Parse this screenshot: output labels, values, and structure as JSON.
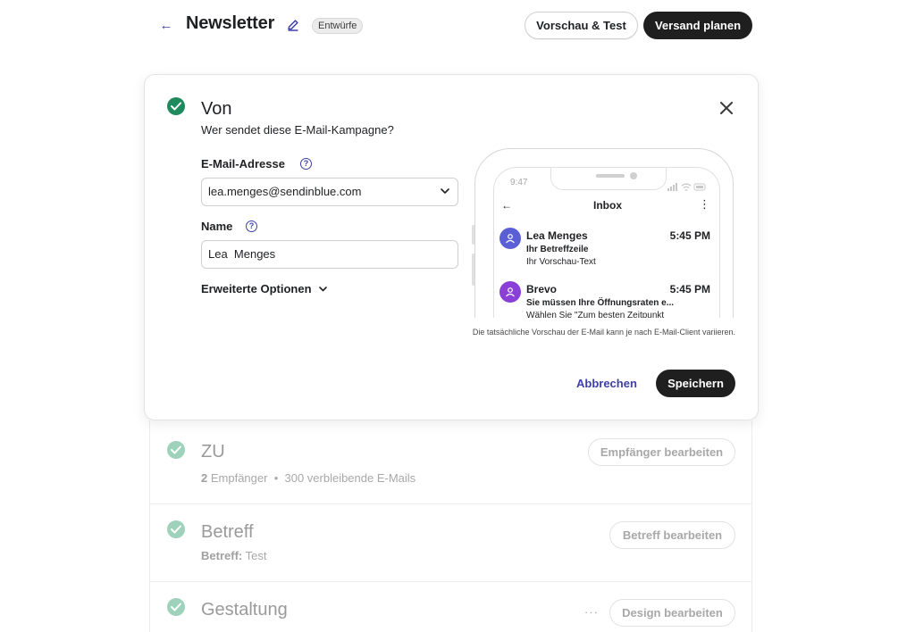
{
  "header": {
    "title": "Newsletter",
    "badge": "Entwürfe",
    "preview_test_label": "Vorschau & Test",
    "schedule_label": "Versand planen"
  },
  "from_section": {
    "title": "Von",
    "subtitle": "Wer sendet diese E-Mail-Kampagne?",
    "email_label": "E-Mail-Adresse",
    "email_value": "lea.menges@sendinblue.com",
    "name_label": "Name",
    "name_value": "Lea  Menges",
    "advanced_label": "Erweiterte Optionen",
    "cancel_label": "Abbrechen",
    "save_label": "Speichern"
  },
  "phone_preview": {
    "time": "9:47",
    "inbox_title": "Inbox",
    "mails": [
      {
        "sender": "Lea Menges",
        "time": "5:45 PM",
        "subject": "Ihr Betreffzeile",
        "preview": "Ihr Vorschau-Text",
        "avatar_color": "#5b5fd6"
      },
      {
        "sender": "Brevo",
        "time": "5:45 PM",
        "subject": "Sie müssen Ihre Öffnungsraten e...",
        "preview": "Wählen Sie \"Zum besten Zeitpunkt",
        "avatar_color": "#8a3fd6"
      }
    ],
    "note": "Die tatsächliche Vorschau der E-Mail kann je nach E-Mail-Client variieren."
  },
  "to_section": {
    "title": "ZU",
    "recipients_count": "2",
    "recipients_label": "Empfänger",
    "remaining": "300 verbleibende E-Mails",
    "edit_label": "Empfänger bearbeiten"
  },
  "subject_section": {
    "title": "Betreff",
    "subject_key": "Betreff:",
    "subject_value": "Test",
    "edit_label": "Betreff bearbeiten"
  },
  "design_section": {
    "title": "Gestaltung",
    "more": "···",
    "edit_label": "Design bearbeiten"
  },
  "colors": {
    "accent": "#3d3fa8",
    "success": "#1f8a5e",
    "dark_button": "#1f1f1f"
  }
}
